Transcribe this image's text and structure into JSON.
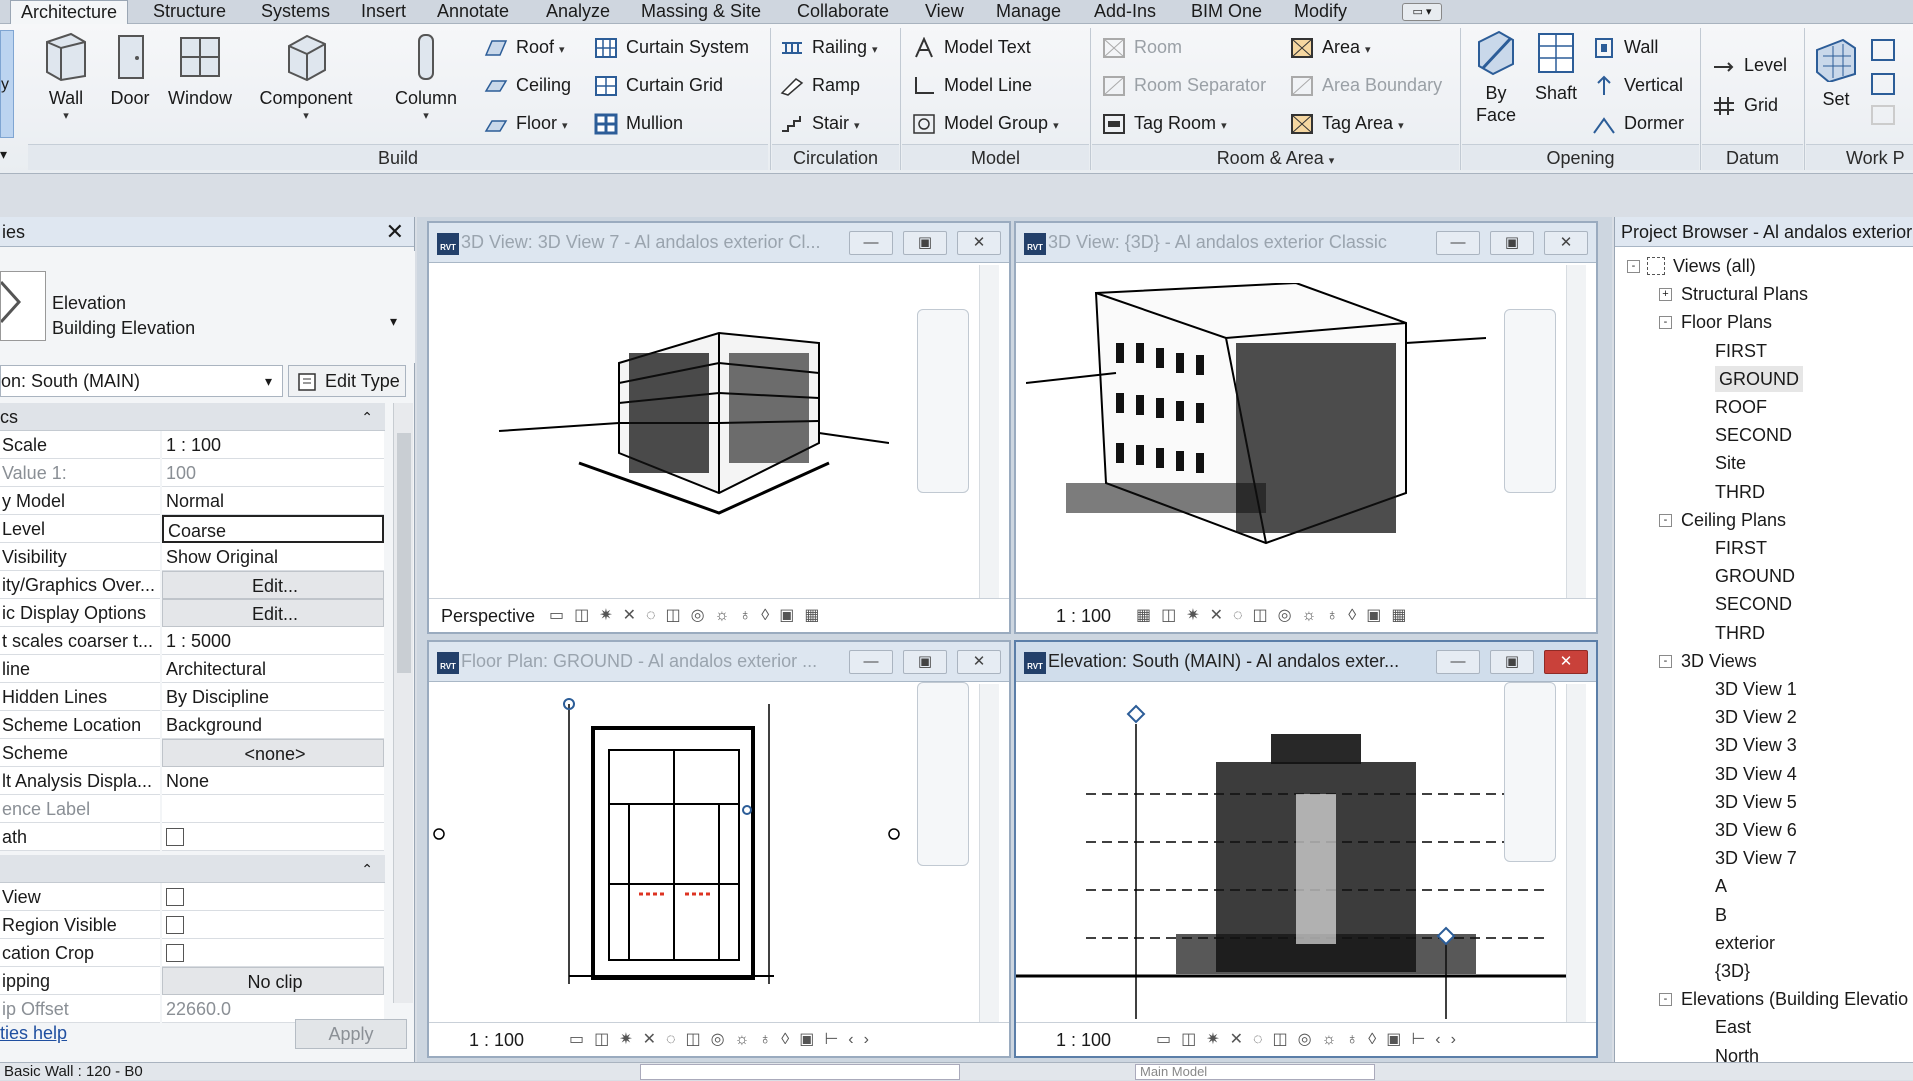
{
  "menubar": {
    "tabs": [
      "Architecture",
      "Structure",
      "Systems",
      "Insert",
      "Annotate",
      "Analyze",
      "Massing & Site",
      "Collaborate",
      "View",
      "Manage",
      "Add-Ins",
      "BIM One",
      "Modify"
    ],
    "active": "Architecture"
  },
  "ribbon": {
    "build": {
      "large": [
        "Wall",
        "Door",
        "Window",
        "Component",
        "Column"
      ],
      "col1": [
        "Roof",
        "Ceiling",
        "Floor"
      ],
      "col2": [
        "Curtain System",
        "Curtain Grid",
        "Mullion"
      ],
      "label": "Build"
    },
    "circulation": {
      "items": [
        "Railing",
        "Ramp",
        "Stair"
      ],
      "label": "Circulation"
    },
    "model": {
      "items": [
        "Model Text",
        "Model Line",
        "Model Group"
      ],
      "label": "Model"
    },
    "room": {
      "col1": [
        "Room",
        "Room Separator",
        "Tag Room"
      ],
      "col2": [
        "Area",
        "Area Boundary",
        "Tag Area"
      ],
      "label": "Room & Area"
    },
    "opening": {
      "byface": "By Face",
      "shaft": "Shaft",
      "items": [
        "Wall",
        "Vertical",
        "Dormer"
      ],
      "label": "Opening"
    },
    "datum": {
      "items": [
        "Level",
        "Grid"
      ],
      "label": "Datum"
    },
    "workplane": {
      "set": "Set",
      "label": "Work P"
    }
  },
  "properties": {
    "title": "ies",
    "type_line1": "Elevation",
    "type_line2": "Building Elevation",
    "selector": "on: South (MAIN)",
    "edit_type": "Edit Type",
    "group1": "cs",
    "rows": [
      {
        "k": "Scale",
        "v": "1 : 100"
      },
      {
        "k": "Value    1:",
        "v": "100",
        "gray": true
      },
      {
        "k": "y Model",
        "v": "Normal"
      },
      {
        "k": "Level",
        "v": "Coarse",
        "sel": true
      },
      {
        "k": "Visibility",
        "v": "Show Original"
      },
      {
        "k": "ity/Graphics Over...",
        "v": "Edit...",
        "btn": true
      },
      {
        "k": "ic Display Options",
        "v": "Edit...",
        "btn": true
      },
      {
        "k": "t scales coarser t...",
        "v": "1 : 5000"
      },
      {
        "k": "line",
        "v": "Architectural"
      },
      {
        "k": "Hidden Lines",
        "v": "By Discipline"
      },
      {
        "k": "Scheme Location",
        "v": "Background"
      },
      {
        "k": "Scheme",
        "v": "<none>",
        "btn": true
      },
      {
        "k": "lt Analysis Displa...",
        "v": "None"
      },
      {
        "k": "ence Label",
        "v": "",
        "gray": true
      },
      {
        "k": "ath",
        "v": "",
        "chk": true
      }
    ],
    "rows2": [
      {
        "k": "View",
        "v": "",
        "chk": true
      },
      {
        "k": "Region Visible",
        "v": "",
        "chk": true
      },
      {
        "k": "cation Crop",
        "v": "",
        "chk": true
      },
      {
        "k": "ipping",
        "v": "No clip",
        "btn": true
      },
      {
        "k": "ip Offset",
        "v": "22660.0",
        "gray": true
      }
    ],
    "help": "ties help",
    "apply": "Apply"
  },
  "views": {
    "v1": {
      "title": "3D View: 3D View 7 - Al andalos exterior Cl...",
      "scale": "Perspective"
    },
    "v2": {
      "title": "3D View: {3D} - Al andalos exterior Classic",
      "scale": "1 : 100"
    },
    "v3": {
      "title": "Floor Plan: GROUND - Al andalos exterior ...",
      "scale": "1 : 100"
    },
    "v4": {
      "title": "Elevation: South (MAIN) - Al andalos exter...",
      "scale": "1 : 100"
    }
  },
  "browser": {
    "title": "Project Browser - Al andalos exterior",
    "items": [
      {
        "t": "Views (all)",
        "lvl": 0,
        "exp": "-"
      },
      {
        "t": "Structural Plans",
        "lvl": 1,
        "exp": "+"
      },
      {
        "t": "Floor Plans",
        "lvl": 1,
        "exp": "-"
      },
      {
        "t": "FIRST",
        "lvl": 2
      },
      {
        "t": "GROUND",
        "lvl": 2,
        "sel": true
      },
      {
        "t": "ROOF",
        "lvl": 2
      },
      {
        "t": "SECOND",
        "lvl": 2
      },
      {
        "t": "Site",
        "lvl": 2
      },
      {
        "t": "THRD",
        "lvl": 2
      },
      {
        "t": "Ceiling Plans",
        "lvl": 1,
        "exp": "-"
      },
      {
        "t": "FIRST",
        "lvl": 2
      },
      {
        "t": "GROUND",
        "lvl": 2
      },
      {
        "t": "SECOND",
        "lvl": 2
      },
      {
        "t": "THRD",
        "lvl": 2
      },
      {
        "t": "3D Views",
        "lvl": 1,
        "exp": "-"
      },
      {
        "t": "3D View 1",
        "lvl": 2
      },
      {
        "t": "3D View 2",
        "lvl": 2
      },
      {
        "t": "3D View 3",
        "lvl": 2
      },
      {
        "t": "3D View 4",
        "lvl": 2
      },
      {
        "t": "3D View 5",
        "lvl": 2
      },
      {
        "t": "3D View 6",
        "lvl": 2
      },
      {
        "t": "3D View 7",
        "lvl": 2
      },
      {
        "t": "A",
        "lvl": 2
      },
      {
        "t": "B",
        "lvl": 2
      },
      {
        "t": "exterior",
        "lvl": 2
      },
      {
        "t": "{3D}",
        "lvl": 2
      },
      {
        "t": "Elevations (Building Elevatio",
        "lvl": 1,
        "exp": "-"
      },
      {
        "t": "East",
        "lvl": 2
      },
      {
        "t": "North",
        "lvl": 2
      }
    ]
  },
  "status": {
    "left": "Basic Wall : 120 - B0",
    "model": "Main Model"
  },
  "colors": {
    "accent": "#23406a",
    "close_red": "#c9413a"
  }
}
